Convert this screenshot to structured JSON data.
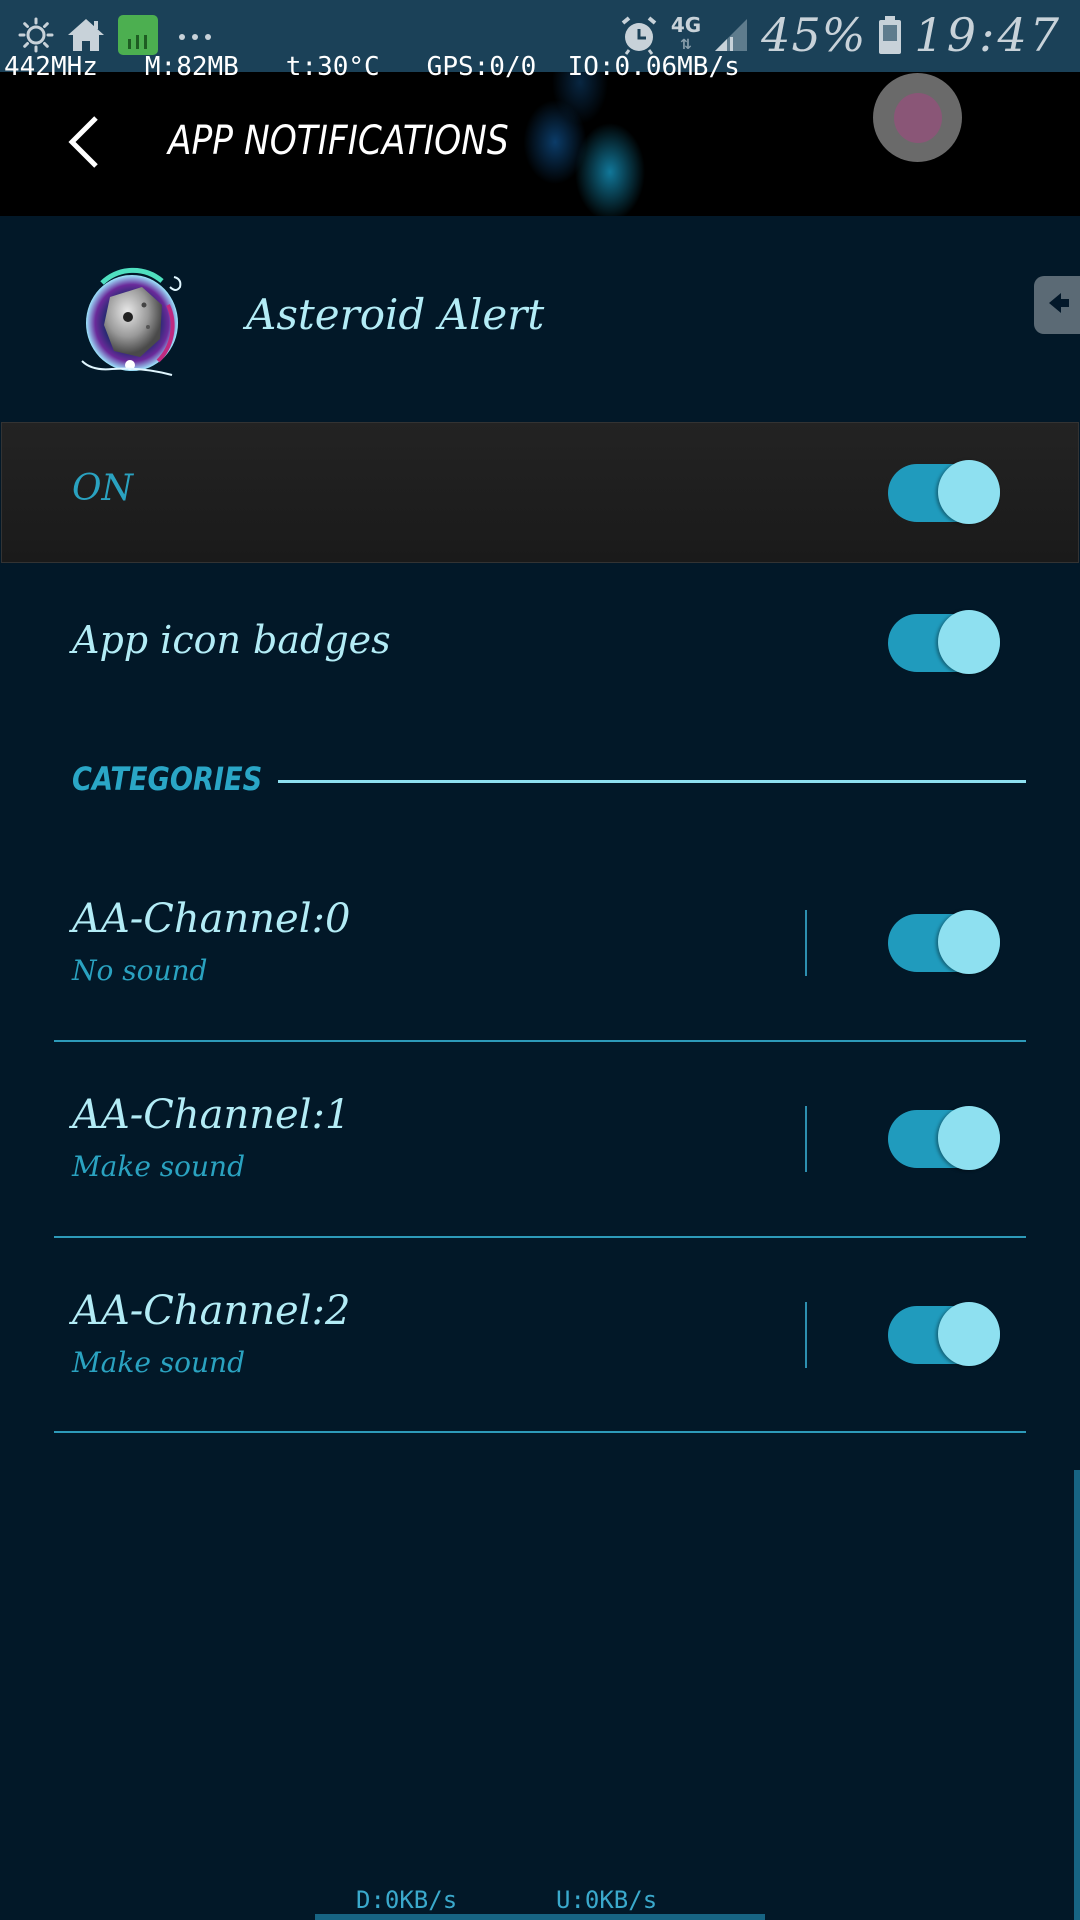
{
  "status_bar": {
    "left_icons": [
      "brightness-icon",
      "home-icon",
      "equalizer-app-icon",
      "more-notifications-icon"
    ],
    "network_type": "4G",
    "battery_percent": "45%",
    "time": "19:47"
  },
  "monitor": {
    "cpu": "442MHz",
    "memory": "M:82MB",
    "temperature": "t:30°C",
    "gps": "GPS:0/0",
    "io": "IO:0.06MB/s"
  },
  "app_bar": {
    "title": "APP NOTIFICATIONS",
    "back_label": "Back"
  },
  "app": {
    "name": "Asteroid Alert"
  },
  "master_toggle": {
    "label": "ON",
    "checked": true
  },
  "settings": [
    {
      "label": "App icon badges",
      "checked": true
    }
  ],
  "categories": {
    "title": "CATEGORIES",
    "channels": [
      {
        "title": "AA-Channel:0",
        "subtitle": "No sound",
        "checked": true
      },
      {
        "title": "AA-Channel:1",
        "subtitle": "Make sound",
        "checked": true
      },
      {
        "title": "AA-Channel:2",
        "subtitle": "Make sound",
        "checked": true
      }
    ]
  },
  "net_speed": {
    "download": "D:0KB/s",
    "upload": "U:0KB/s"
  },
  "colors": {
    "background": "#021828",
    "status_bar": "#1b4158",
    "accent": "#209bbd",
    "toggle_thumb": "#8ee0f0",
    "text_primary": "#b3ecf6",
    "text_secondary": "#2aa2c0"
  }
}
